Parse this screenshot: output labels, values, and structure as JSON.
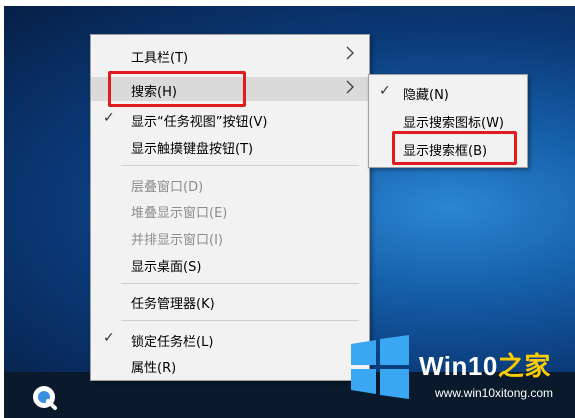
{
  "menu": {
    "items": [
      {
        "label": "工具栏(T)"
      },
      {
        "label": "搜索(H)"
      },
      {
        "label": "显示“任务视图”按钮(V)"
      },
      {
        "label": "显示触摸键盘按钮(T)"
      },
      {
        "label": "层叠窗口(D)"
      },
      {
        "label": "堆叠显示窗口(E)"
      },
      {
        "label": "并排显示窗口(I)"
      },
      {
        "label": "显示桌面(S)"
      },
      {
        "label": "任务管理器(K)"
      },
      {
        "label": "锁定任务栏(L)"
      },
      {
        "label": "属性(R)"
      }
    ],
    "check_mark": "✓"
  },
  "submenu": {
    "items": [
      {
        "label": "隐藏(N)"
      },
      {
        "label": "显示搜索图标(W)"
      },
      {
        "label": "显示搜索框(B)"
      }
    ]
  },
  "watermark": {
    "title_prefix": "Win10",
    "title_suffix": "之家",
    "url": "www.win10xitong.com"
  },
  "colors": {
    "highlight": "#e01c1c",
    "menu_bg": "#f2f2f2",
    "hover_bg": "#dadada",
    "taskbar": "#0a1a2c"
  },
  "icons": {
    "submenu_arrow": "chevron-right-icon",
    "start": "cortana-icon",
    "logo": "windows-logo-icon"
  }
}
